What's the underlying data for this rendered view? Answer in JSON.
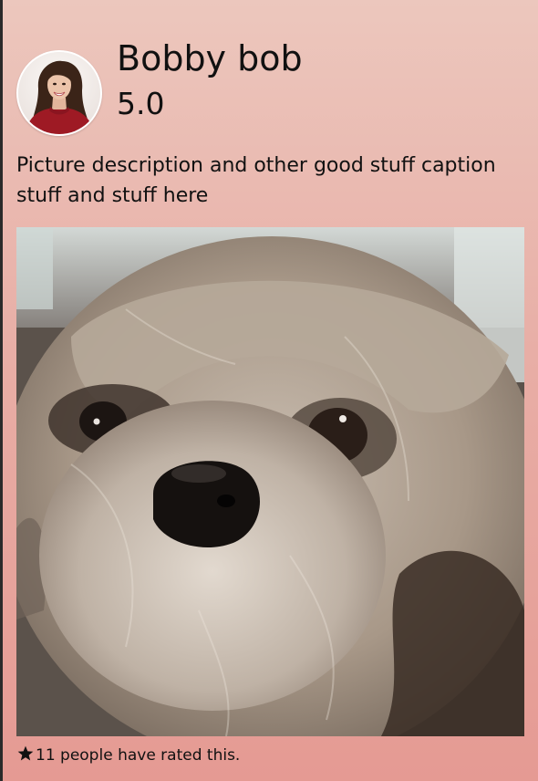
{
  "post": {
    "user_name": "Bobby bob",
    "rating": "5.0",
    "caption": "Picture description and other good stuff caption stuff and stuff here",
    "rating_count_text": "11 people have rated this."
  },
  "icons": {
    "avatar": "profile-photo",
    "rating_star": "star-icon"
  },
  "colors": {
    "background_top": "#ecc7bd",
    "background_bottom": "#e59a93",
    "text": "#111111"
  }
}
